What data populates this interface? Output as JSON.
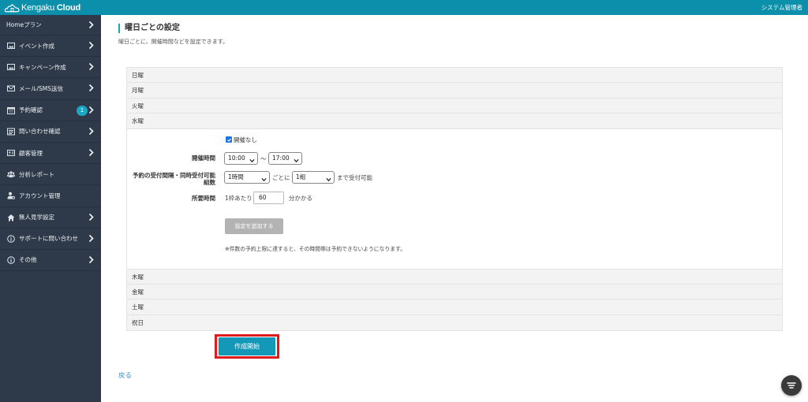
{
  "header": {
    "logo_text_a": "Kengaku",
    "logo_text_b": "Cloud",
    "user_label": "システム管理者"
  },
  "sidebar": {
    "items": [
      {
        "label": "Homeプラン",
        "icon": "none",
        "has_chevron": true
      },
      {
        "label": "イベント作成",
        "icon": "image-icon",
        "has_chevron": true
      },
      {
        "label": "キャンペーン作成",
        "icon": "image-icon",
        "has_chevron": true
      },
      {
        "label": "メール/SMS送信",
        "icon": "mail-icon",
        "has_chevron": true
      },
      {
        "label": "予約確認",
        "icon": "calendar-icon",
        "has_chevron": true,
        "badge": "1"
      },
      {
        "label": "問い合わせ確認",
        "icon": "list-icon",
        "has_chevron": true
      },
      {
        "label": "顧客管理",
        "icon": "id-card-icon",
        "has_chevron": true
      },
      {
        "label": "分析レポート",
        "icon": "users-icon",
        "has_chevron": false
      },
      {
        "label": "アカウント管理",
        "icon": "user-gear-icon",
        "has_chevron": false
      },
      {
        "label": "無人見学設定",
        "icon": "home-icon",
        "has_chevron": true
      },
      {
        "label": "サポートに問い合わせ",
        "icon": "info-icon",
        "has_chevron": true
      },
      {
        "label": "その他",
        "icon": "info-icon",
        "has_chevron": true
      }
    ]
  },
  "main": {
    "title": "曜日ごとの設定",
    "description": "曜日ごとに、開催時間などを設定できます。",
    "days": [
      "日曜",
      "月曜",
      "火曜",
      "水曜",
      "木曜",
      "金曜",
      "土曜",
      "祝日"
    ],
    "expanded_day": "水曜",
    "form": {
      "no_event_checkbox_label": "開催なし",
      "no_event_checked": true,
      "hours_label": "開催時間",
      "start_time": "10:00",
      "tilde": "～",
      "end_time": "17:00",
      "interval_label_line1": "予約の受付間隔・同時受付可能",
      "interval_label_line2": "組数",
      "interval_value": "1時間",
      "per_text": "ごとに",
      "groups_value": "1組",
      "accept_text": "まで受付可能",
      "duration_label": "所要時間",
      "per_slot_text": "1枠あたり",
      "duration_value": "60",
      "minutes_text": "分かかる",
      "add_setting_button": "設定を追加する",
      "note": "※件数の予約上限に達すると、その時間帯は予約できないようになります。"
    },
    "start_button": "作成開始",
    "back_link": "戻る"
  },
  "colors": {
    "header_bg": "#0c8fab",
    "sidebar_bg": "#2e3a4a",
    "accent": "#1aa6c5",
    "highlight_outline": "#e01b1b",
    "link": "#2a8fd0"
  }
}
